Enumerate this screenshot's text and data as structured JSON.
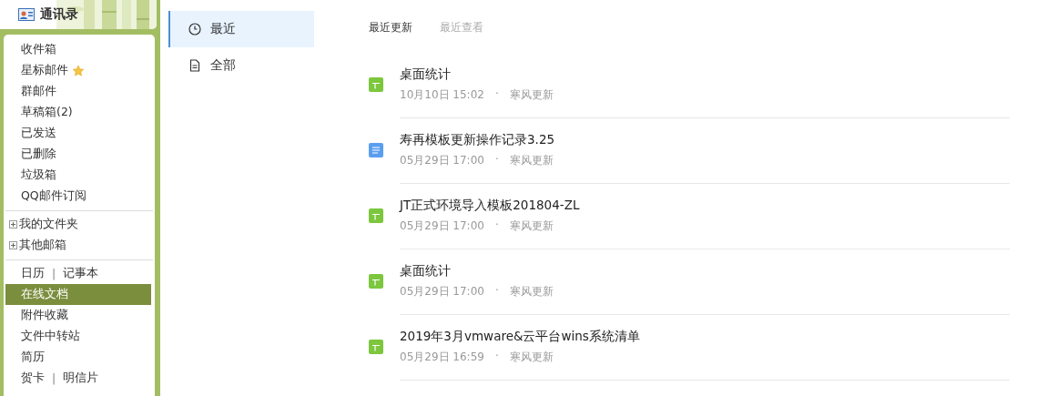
{
  "sidebar": {
    "header": {
      "title": "通讯录"
    },
    "groups": [
      {
        "items": [
          {
            "kind": "folder",
            "label": "收件箱",
            "selected": false
          },
          {
            "kind": "star",
            "label": "星标邮件",
            "selected": false
          },
          {
            "kind": "folder",
            "label": "群邮件",
            "selected": false
          },
          {
            "kind": "folder",
            "label": "草稿箱(2)",
            "selected": false
          },
          {
            "kind": "folder",
            "label": "已发送",
            "selected": false
          },
          {
            "kind": "folder",
            "label": "已删除",
            "selected": false
          },
          {
            "kind": "folder",
            "label": "垃圾箱",
            "selected": false
          },
          {
            "kind": "folder",
            "label": "QQ邮件订阅",
            "selected": false
          }
        ]
      },
      {
        "items": [
          {
            "kind": "expandable",
            "label": "我的文件夹",
            "expanded": false,
            "selected": false
          },
          {
            "kind": "expandable",
            "label": "其他邮箱",
            "expanded": false,
            "selected": false
          }
        ]
      },
      {
        "items": [
          {
            "kind": "pair",
            "label": "日历",
            "separator": "|",
            "label_2": "记事本",
            "selected": false
          },
          {
            "kind": "folder",
            "label": "在线文档",
            "selected": true
          },
          {
            "kind": "folder",
            "label": "附件收藏",
            "selected": false
          },
          {
            "kind": "folder",
            "label": "文件中转站",
            "selected": false
          },
          {
            "kind": "folder",
            "label": "简历",
            "selected": false
          },
          {
            "kind": "pair",
            "label": "贺卡",
            "separator": "|",
            "label_2": "明信片",
            "selected": false
          }
        ]
      }
    ]
  },
  "nav": [
    {
      "kind": "recent",
      "label": "最近",
      "selected": true
    },
    {
      "kind": "all",
      "label": "全部",
      "selected": false
    }
  ],
  "tabs": [
    {
      "label": "最近更新",
      "selected": true
    },
    {
      "label": "最近查看",
      "selected": false
    }
  ],
  "documents": [
    {
      "kind": "sheet",
      "title": "桌面统计",
      "time": "10月10日 15:02",
      "separator": "·",
      "editor": "寒风更新"
    },
    {
      "kind": "doc",
      "title": "寿再模板更新操作记录3.25",
      "time": "05月29日 17:00",
      "separator": "·",
      "editor": "寒风更新"
    },
    {
      "kind": "sheet",
      "title": "JT正式环境导入模板201804-ZL",
      "time": "05月29日 17:00",
      "separator": "·",
      "editor": "寒风更新"
    },
    {
      "kind": "sheet",
      "title": "桌面统计",
      "time": "05月29日 17:00",
      "separator": "·",
      "editor": "寒风更新"
    },
    {
      "kind": "sheet",
      "title": "2019年3月vmware&云平台wins系统清单",
      "time": "05月29日 16:59",
      "separator": "·",
      "editor": "寒风更新"
    }
  ]
}
